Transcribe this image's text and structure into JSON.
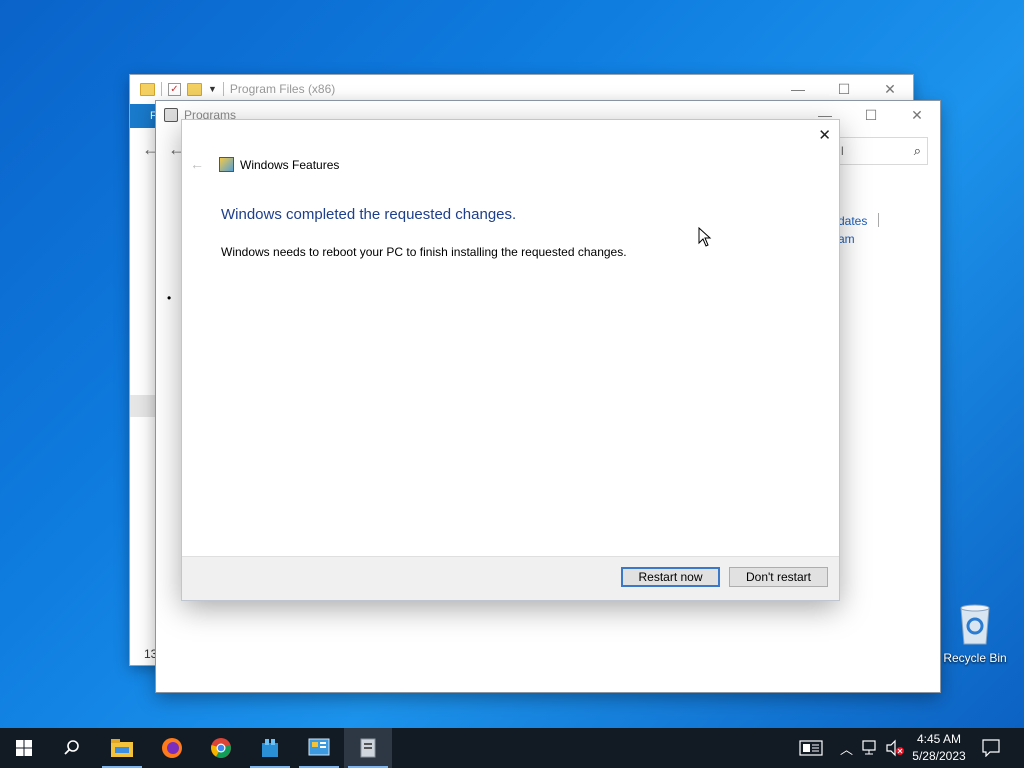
{
  "explorer": {
    "title": "Program Files (x86)",
    "ribbon_tab": "F",
    "status_count": "13",
    "min": "—",
    "max": "☐",
    "close": "✕"
  },
  "control_panel": {
    "title": "Programs",
    "search_placeholder": "l",
    "link_updates": "dates",
    "link_program": "am",
    "min": "—",
    "max": "☐",
    "close": "✕"
  },
  "dialog": {
    "title": "Windows Features",
    "heading": "Windows completed the requested changes.",
    "message": "Windows needs to reboot your PC to finish installing the requested changes.",
    "restart_label": "Restart now",
    "dont_restart_label": "Don't restart",
    "close": "✕",
    "back": "←"
  },
  "desktop": {
    "recycle_bin_label": "Recycle Bin"
  },
  "taskbar": {
    "apps": [
      "start-icon",
      "search-icon",
      "file-explorer-icon",
      "firefox-icon",
      "chrome-icon",
      "app-icon",
      "control-panel-icon",
      "windows-features-icon"
    ],
    "time": "4:45 AM",
    "date": "5/28/2023",
    "accent": "#0078d7"
  }
}
